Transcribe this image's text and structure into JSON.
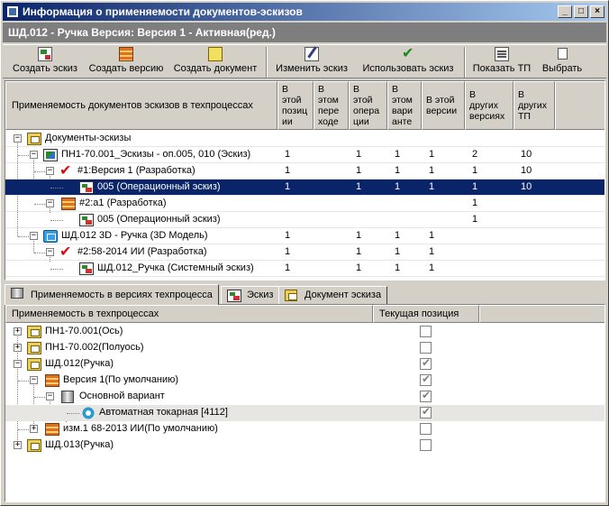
{
  "window": {
    "title": "Информация о применяемости документов-эскизов",
    "buttons": [
      "_",
      "□",
      "×"
    ]
  },
  "document": {
    "header": "ШД.012 - Ручка Версия: Версия 1 -  Активная(ред.)"
  },
  "toolbar": {
    "create_sketch": "Создать эскиз",
    "create_version": "Создать версию",
    "create_document": "Создать документ",
    "edit_sketch": "Изменить эскиз",
    "use_sketch": "Использовать эскиз",
    "show_tp": "Показать ТП",
    "select": "Выбрать"
  },
  "upper_grid": {
    "columns": [
      "Применяемость документов эскизов в техпроцессах",
      "В этой позиц ии",
      "В этом пере ходе",
      "В этой опера ции",
      "В этом вари анте",
      "В этой версии",
      "В других версиях",
      "В других ТП"
    ],
    "column_lines": [
      [
        "Применяемость документов эскизов в техпроцессах"
      ],
      [
        "В",
        "этой",
        "позиц",
        "ии"
      ],
      [
        "В",
        "этом",
        "пере",
        "ходе"
      ],
      [
        "В",
        "этой",
        "опера",
        "ции"
      ],
      [
        "В",
        "этом",
        "вари",
        "анте"
      ],
      [
        "В этой",
        "версии"
      ],
      [
        "В",
        "других",
        "версиях"
      ],
      [
        "В",
        "других",
        "ТП"
      ]
    ],
    "rows": [
      {
        "label": "Документы-эскизы",
        "icon": "documents-folder-icon",
        "values": [
          "",
          "",
          "",
          "",
          "",
          "",
          ""
        ]
      },
      {
        "label": "ПН1-70.001_Эскизы - оп.005, 010 (Эскиз)",
        "icon": "picture-sketch-icon",
        "values": [
          "1",
          "",
          "1",
          "1",
          "1",
          "2",
          "10"
        ]
      },
      {
        "label": "#1:Версия 1 (Разработка)",
        "icon": "red-check-icon",
        "values": [
          "1",
          "",
          "1",
          "1",
          "1",
          "1",
          "10"
        ]
      },
      {
        "label": "005 (Операционный эскиз)",
        "icon": "operation-sketch-icon",
        "values": [
          "1",
          "",
          "1",
          "1",
          "1",
          "1",
          "10"
        ],
        "selected": true
      },
      {
        "label": "#2:a1 (Разработка)",
        "icon": "table-icon",
        "values": [
          "",
          "",
          "",
          "",
          "",
          "1",
          ""
        ]
      },
      {
        "label": "005 (Операционный эскиз)",
        "icon": "operation-sketch-icon",
        "values": [
          "",
          "",
          "",
          "",
          "",
          "1",
          ""
        ]
      },
      {
        "label": "ШД.012 3D - Ручка (3D Модель)",
        "icon": "3d-model-icon",
        "values": [
          "1",
          "",
          "1",
          "1",
          "1",
          "",
          ""
        ]
      },
      {
        "label": "#2:58-2014 ИИ (Разработка)",
        "icon": "red-check-icon",
        "values": [
          "1",
          "",
          "1",
          "1",
          "1",
          "",
          ""
        ]
      },
      {
        "label": "ШД.012_Ручка (Системный эскиз)",
        "icon": "system-sketch-icon",
        "values": [
          "1",
          "",
          "1",
          "1",
          "1",
          "",
          ""
        ]
      }
    ]
  },
  "tabs": [
    {
      "label": "Применяемость в версиях техпроцесса",
      "icon": "applicability-icon",
      "active": true
    },
    {
      "label": "Эскиз",
      "icon": "sketch-icon",
      "active": false
    },
    {
      "label": "Документ эскиза",
      "icon": "document-icon",
      "active": false
    }
  ],
  "lower_grid": {
    "columns": [
      "Применяемость в техпроцессах",
      "Текущая позиция"
    ],
    "rows": [
      {
        "label": "ПН1-70.001(Ось)",
        "checked": false
      },
      {
        "label": "ПН1-70.002(Полуось)",
        "checked": false
      },
      {
        "label": "ШД.012(Ручка)",
        "checked": true
      },
      {
        "label": "Версия 1(По умолчанию)",
        "checked": true
      },
      {
        "label": "Основной вариант",
        "checked": true
      },
      {
        "label": "Автоматная токарная [4112]",
        "checked": true
      },
      {
        "label": "изм.1 68-2013 ИИ(По умолчанию)",
        "checked": false
      },
      {
        "label": "ШД.013(Ручка)",
        "checked": false
      }
    ]
  }
}
